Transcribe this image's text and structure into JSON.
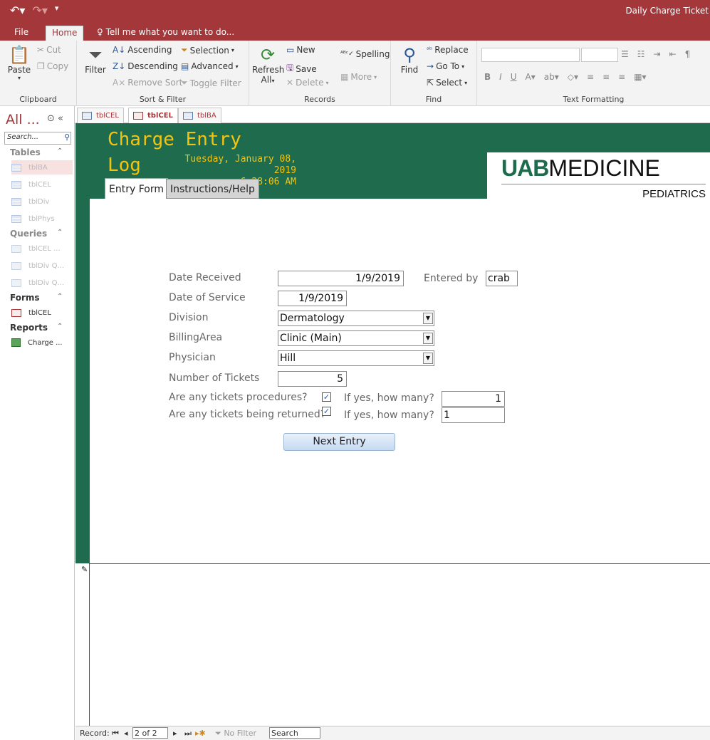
{
  "window": {
    "title": "Daily Charge Ticket"
  },
  "ribbon": {
    "tabs": [
      "File",
      "Home"
    ],
    "tell_me": "Tell me what you want to do...",
    "clipboard": {
      "paste": "Paste",
      "cut": "Cut",
      "copy": "Copy",
      "label": "Clipboard"
    },
    "sort_filter": {
      "filter": "Filter",
      "ascending": "Ascending",
      "descending": "Descending",
      "remove_sort": "Remove Sort",
      "selection": "Selection",
      "advanced": "Advanced",
      "toggle_filter": "Toggle Filter",
      "label": "Sort & Filter"
    },
    "records": {
      "refresh": "Refresh",
      "refresh_all": "All",
      "new": "New",
      "save": "Save",
      "delete": "Delete",
      "spelling": "Spelling",
      "more": "More",
      "label": "Records"
    },
    "find": {
      "find": "Find",
      "replace": "Replace",
      "go_to": "Go To",
      "select": "Select",
      "label": "Find"
    },
    "text_formatting": {
      "label": "Text Formatting",
      "bold": "B",
      "italic": "I",
      "underline": "U"
    }
  },
  "nav": {
    "header": "All ...",
    "search_placeholder": "Search...",
    "sections": {
      "tables": "Tables",
      "queries": "Queries",
      "forms": "Forms",
      "reports": "Reports"
    },
    "tables": [
      "tblBA",
      "tblCEL",
      "tblDiv",
      "tblPhys"
    ],
    "queries": [
      "tblCEL ...",
      "tblDiv Q...",
      "tblDiv Q..."
    ],
    "forms": [
      "tblCEL"
    ],
    "reports": [
      "Charge ..."
    ]
  },
  "doc_tabs": [
    "tblCEL",
    "tblCEL",
    "tblBA"
  ],
  "form": {
    "title": "Charge Entry Log",
    "date": "Tuesday, January 08, 2019",
    "time": "6:28:06 AM",
    "logo_main_a": "UAB",
    "logo_main_b": "MEDICINE",
    "logo_sub": "PEDIATRICS",
    "tabs": [
      "Entry Form",
      "Instructions/Help"
    ],
    "fields": {
      "date_received_label": "Date Received",
      "date_received": "1/9/2019",
      "entered_by_label": "Entered by",
      "entered_by": "crab",
      "date_of_service_label": "Date of Service",
      "date_of_service": "1/9/2019",
      "division_label": "Division",
      "division": "Dermatology",
      "billing_area_label": "BillingArea",
      "billing_area": "Clinic (Main)",
      "physician_label": "Physician",
      "physician": "Hill",
      "num_tickets_label": "Number of Tickets",
      "num_tickets": "5",
      "procedures_label": "Are any tickets procedures?",
      "procedures_checked": true,
      "procedures_howmany_label": "If yes, how many?",
      "procedures_howmany": "1",
      "returned_label": "Are any tickets being returned?",
      "returned_checked": true,
      "returned_howmany_label": "If yes, how many?",
      "returned_howmany": "1"
    },
    "next_button": "Next Entry"
  },
  "status": {
    "record_label": "Record:",
    "record_value": "2 of 2",
    "filter": "No Filter",
    "search": "Search"
  },
  "colors": {
    "title_bar": "#a4373a",
    "form_header": "#1f6b4e",
    "title_text": "#f2c40f"
  }
}
